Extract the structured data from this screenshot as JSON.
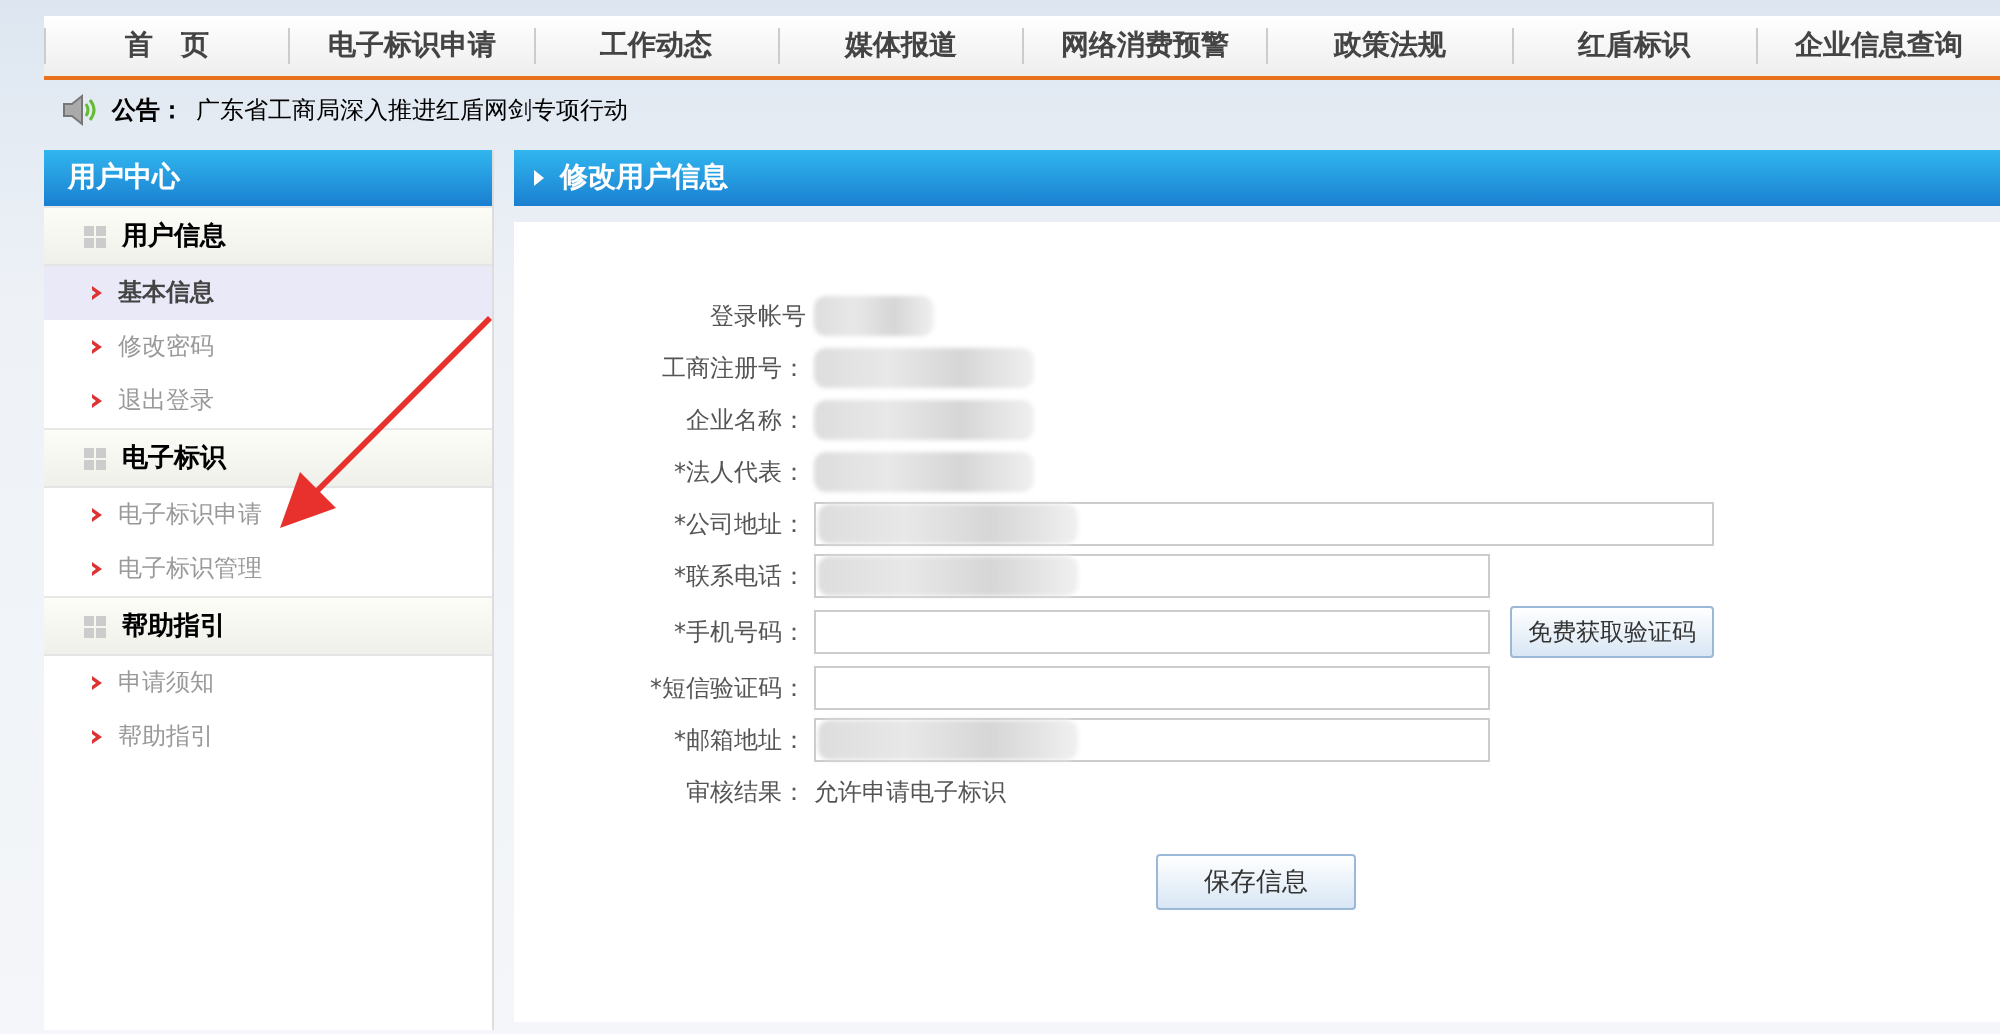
{
  "nav": [
    {
      "label": "首　页"
    },
    {
      "label": "电子标识申请"
    },
    {
      "label": "工作动态"
    },
    {
      "label": "媒体报道"
    },
    {
      "label": "网络消费预警"
    },
    {
      "label": "政策法规"
    },
    {
      "label": "红盾标识"
    },
    {
      "label": "企业信息查询"
    }
  ],
  "notice": {
    "label": "公告：",
    "text": "广东省工商局深入推进红盾网剑专项行动"
  },
  "sidebar": {
    "title": "用户中心",
    "groups": [
      {
        "title": "用户信息",
        "items": [
          {
            "label": "基本信息",
            "selected": true
          },
          {
            "label": "修改密码",
            "selected": false
          },
          {
            "label": "退出登录",
            "selected": false
          }
        ]
      },
      {
        "title": "电子标识",
        "items": [
          {
            "label": "电子标识申请",
            "selected": false
          },
          {
            "label": "电子标识管理",
            "selected": false
          }
        ]
      },
      {
        "title": "帮助指引",
        "items": [
          {
            "label": "申请须知",
            "selected": false
          },
          {
            "label": "帮助指引",
            "selected": false
          }
        ]
      }
    ]
  },
  "panel": {
    "title": "修改用户信息",
    "fields": [
      {
        "kind": "text",
        "label": "登录帐号",
        "redacted": true
      },
      {
        "kind": "text",
        "label": "工商注册号：",
        "redacted": true
      },
      {
        "kind": "text",
        "label": "企业名称：",
        "redacted": true
      },
      {
        "kind": "text",
        "label": "*法人代表：",
        "redacted": true
      },
      {
        "kind": "wide-input",
        "label": "*公司地址：",
        "redacted": true
      },
      {
        "kind": "input",
        "label": "*联系电话：",
        "redacted": true
      },
      {
        "kind": "input-button",
        "label": "*手机号码：",
        "redacted": false,
        "button": "免费获取验证码"
      },
      {
        "kind": "input",
        "label": "*短信验证码：",
        "redacted": false
      },
      {
        "kind": "input",
        "label": "*邮箱地址：",
        "redacted": true
      },
      {
        "kind": "text",
        "label": "审核结果：",
        "redacted": false,
        "value": "允许申请电子标识"
      }
    ],
    "save": "保存信息"
  }
}
